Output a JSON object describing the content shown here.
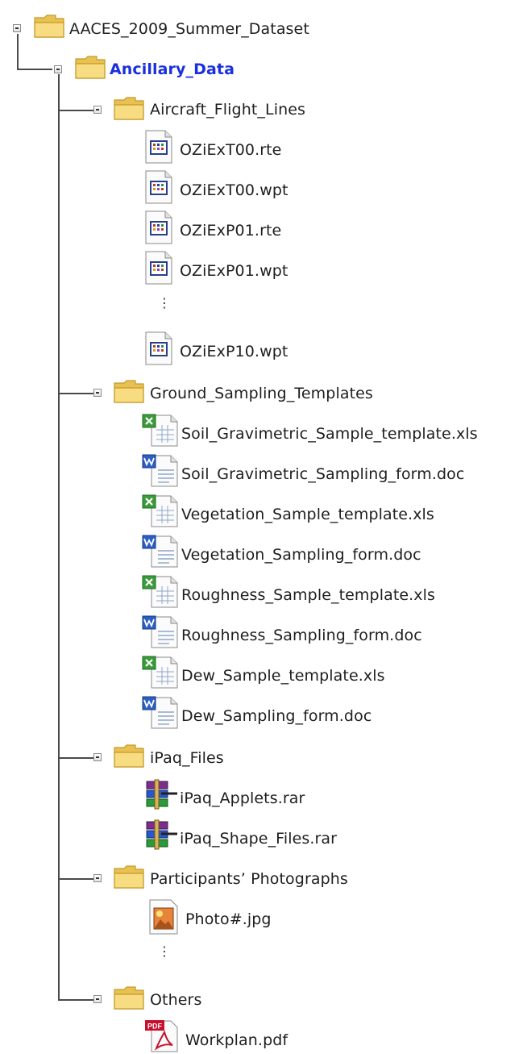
{
  "tree": {
    "root": {
      "label": "AACES_2009_Summer_Dataset",
      "children": [
        {
          "label": "Ancillary_Data",
          "children": [
            {
              "label": "Aircraft_Flight_Lines",
              "files": [
                {
                  "name": "OZiExT00.rte",
                  "icon": "data-file-icon"
                },
                {
                  "name": "OZiExT00.wpt",
                  "icon": "data-file-icon"
                },
                {
                  "name": "OZiExP01.rte",
                  "icon": "data-file-icon"
                },
                {
                  "name": "OZiExP01.wpt",
                  "icon": "data-file-icon"
                },
                {
                  "name": "⋮",
                  "icon": "ellipsis"
                },
                {
                  "name": "OZiExP10.wpt",
                  "icon": "data-file-icon"
                }
              ]
            },
            {
              "label": "Ground_Sampling_Templates",
              "files": [
                {
                  "name": "Soil_Gravimetric_Sample_template.xls",
                  "icon": "excel-file-icon"
                },
                {
                  "name": "Soil_Gravimetric_Sampling_form.doc",
                  "icon": "word-file-icon"
                },
                {
                  "name": "Vegetation_Sample_template.xls",
                  "icon": "excel-file-icon"
                },
                {
                  "name": "Vegetation_Sampling_form.doc",
                  "icon": "word-file-icon"
                },
                {
                  "name": "Roughness_Sample_template.xls",
                  "icon": "excel-file-icon"
                },
                {
                  "name": "Roughness_Sampling_form.doc",
                  "icon": "word-file-icon"
                },
                {
                  "name": "Dew_Sample_template.xls",
                  "icon": "excel-file-icon"
                },
                {
                  "name": "Dew_Sampling_form.doc",
                  "icon": "word-file-icon"
                }
              ]
            },
            {
              "label": "iPaq_Files",
              "files": [
                {
                  "name": "iPaq_Applets.rar",
                  "icon": "rar-archive-icon"
                },
                {
                  "name": "iPaq_Shape_Files.rar",
                  "icon": "rar-archive-icon"
                }
              ]
            },
            {
              "label": "Participants’ Photographs",
              "files": [
                {
                  "name": "Photo#.jpg",
                  "icon": "image-file-icon"
                },
                {
                  "name": "⋮",
                  "icon": "ellipsis"
                }
              ]
            },
            {
              "label": "Others",
              "files": [
                {
                  "name": "Workplan.pdf",
                  "icon": "pdf-file-icon"
                }
              ]
            }
          ]
        }
      ]
    }
  },
  "colors": {
    "highlight_label": "#1a2fe0",
    "folder_fill": "#f6d36a",
    "connector": "#4a4a4a"
  }
}
